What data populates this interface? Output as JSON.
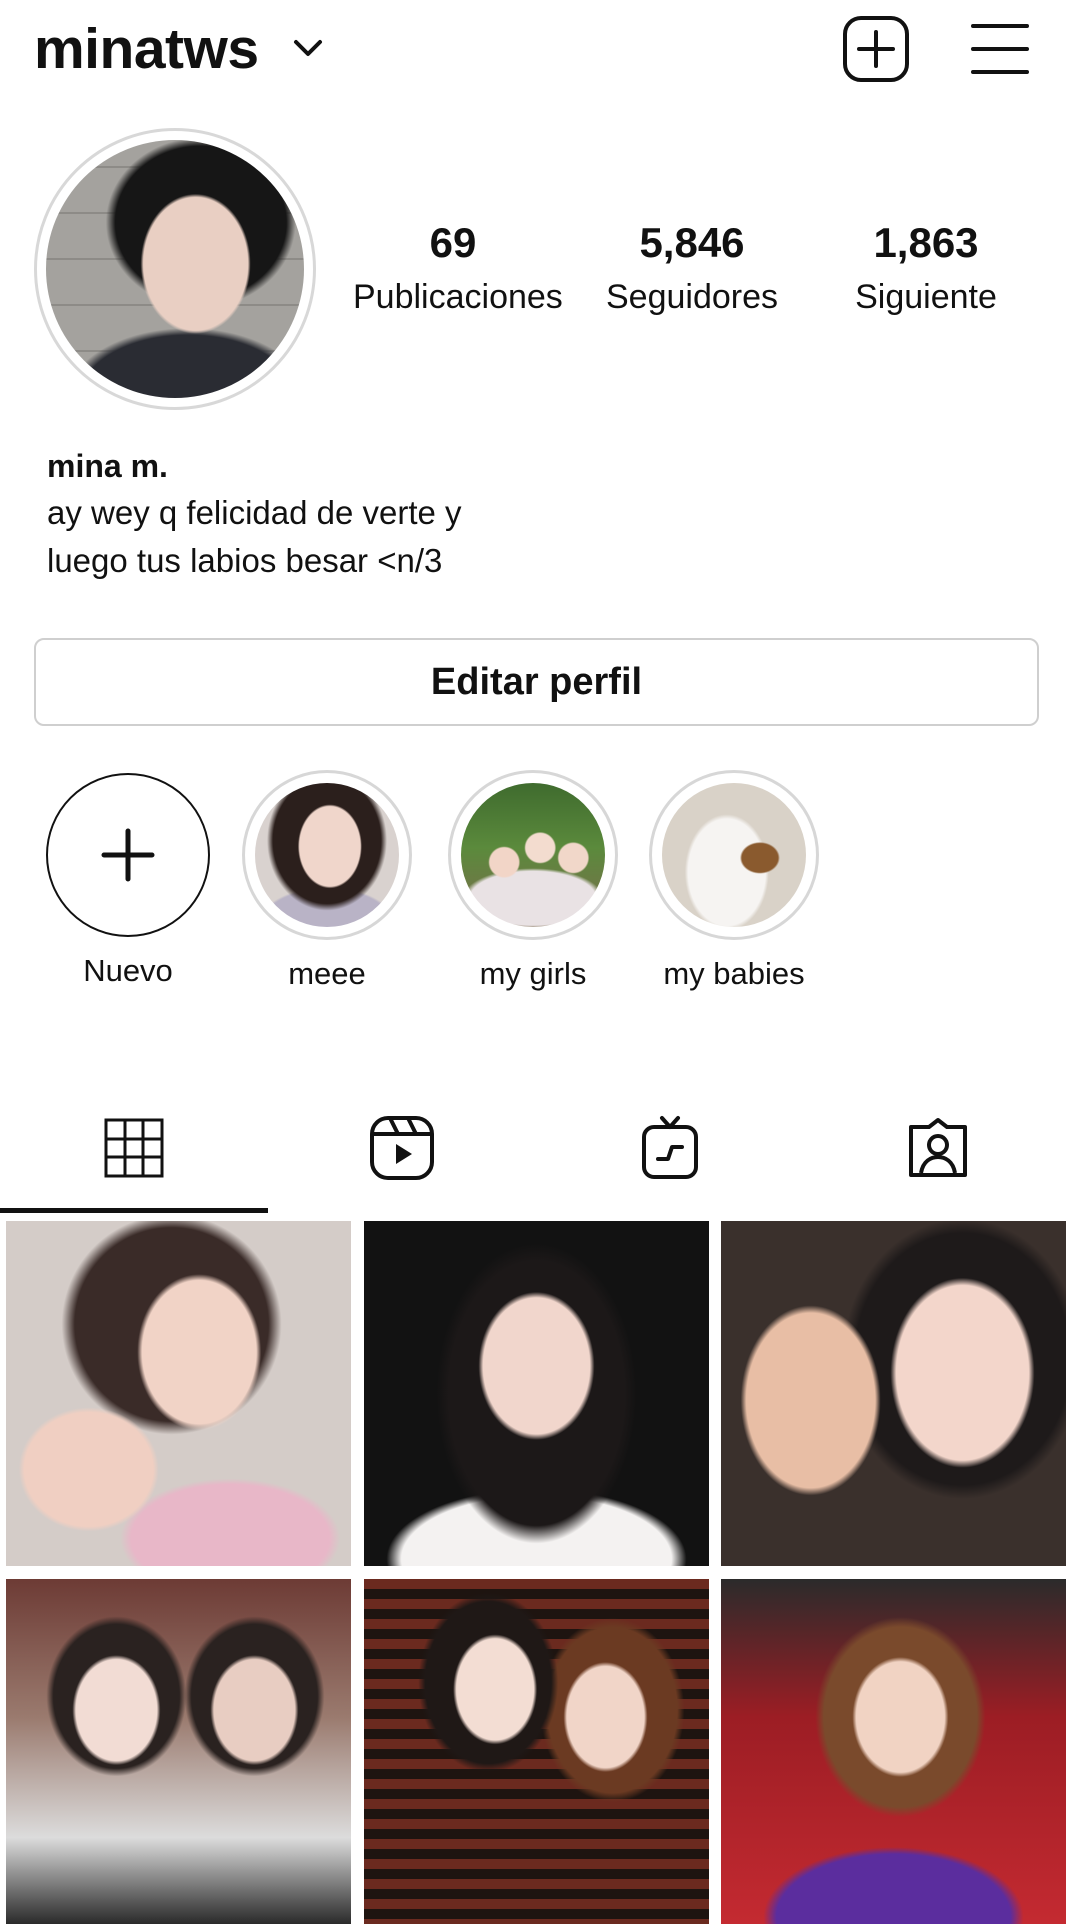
{
  "header": {
    "username": "minatws",
    "icons": {
      "dropdown": "chevron-down-icon",
      "new_post": "plus-square-icon",
      "menu": "hamburger-menu-icon"
    }
  },
  "profile": {
    "avatar": "avatar",
    "stats": [
      {
        "value": "69",
        "label": "Publicaciones"
      },
      {
        "value": "5,846",
        "label": "Seguidores"
      },
      {
        "value": "1,863",
        "label": "Siguiente"
      }
    ],
    "bio": {
      "name": "mina m.",
      "line1": "ay wey q felicidad de verte y",
      "line2": "luego tus labios besar <n/3"
    },
    "edit_button": "Editar perfil"
  },
  "highlights": [
    {
      "label": "Nuevo",
      "kind": "new"
    },
    {
      "label": "meee",
      "kind": "story"
    },
    {
      "label": "my girls",
      "kind": "story"
    },
    {
      "label": "my babies",
      "kind": "story"
    }
  ],
  "tabs": [
    {
      "name": "grid",
      "icon": "grid-icon",
      "active": true
    },
    {
      "name": "reels",
      "icon": "reels-icon",
      "active": false
    },
    {
      "name": "igtv",
      "icon": "igtv-icon",
      "active": false
    },
    {
      "name": "tagged",
      "icon": "tagged-person-icon",
      "active": false
    }
  ],
  "posts": {
    "count_visible": 6
  },
  "colors": {
    "text": "#111111",
    "border": "#cfcfcf",
    "ring": "#d7d7d7",
    "background": "#ffffff"
  }
}
